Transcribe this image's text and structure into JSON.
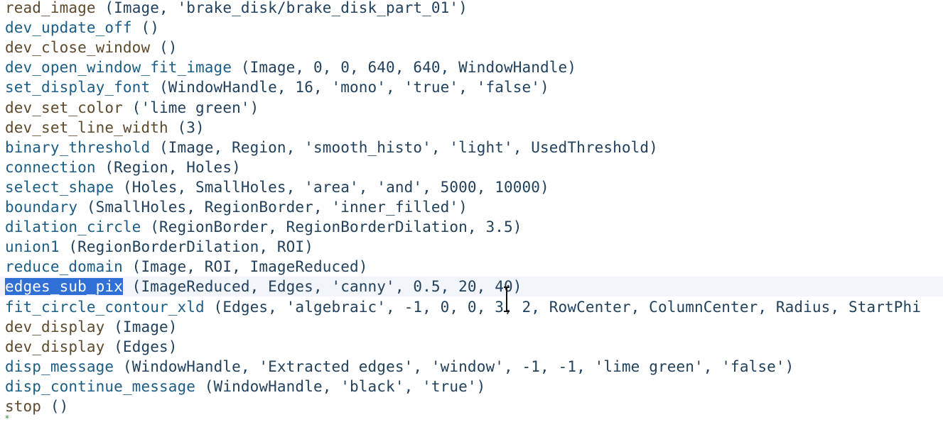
{
  "editor": {
    "lines": [
      {
        "op": "read_image",
        "args": " (Image, 'brake_disk/brake_disk_part_01')",
        "color": "#5e4a2c"
      },
      {
        "op": "dev_update_off",
        "args": " ()",
        "color": "#1a5d86"
      },
      {
        "op": "dev_close_window",
        "args": " ()",
        "color": "#5e4a2c"
      },
      {
        "op": "dev_open_window_fit_image",
        "args": " (Image, 0, 0, 640, 640, WindowHandle)",
        "color": "#1a5d86"
      },
      {
        "op": "set_display_font",
        "args": " (WindowHandle, 16, 'mono', 'true', 'false')",
        "color": "#1a5d86"
      },
      {
        "op": "dev_set_color",
        "args": " ('lime green')",
        "color": "#5e4a2c"
      },
      {
        "op": "dev_set_line_width",
        "args": " (3)",
        "color": "#5e4a2c"
      },
      {
        "op": "binary_threshold",
        "args": " (Image, Region, 'smooth_histo', 'light', UsedThreshold)",
        "color": "#1a5d86"
      },
      {
        "op": "connection",
        "args": " (Region, Holes)",
        "color": "#1a5d86"
      },
      {
        "op": "select_shape",
        "args": " (Holes, SmallHoles, 'area', 'and', 5000, 10000)",
        "color": "#1a5d86"
      },
      {
        "op": "boundary",
        "args": " (SmallHoles, RegionBorder, 'inner_filled')",
        "color": "#1a5d86"
      },
      {
        "op": "dilation_circle",
        "args": " (RegionBorder, RegionBorderDilation, 3.5)",
        "color": "#1a5d86"
      },
      {
        "op": "union1",
        "args": " (RegionBorderDilation, ROI)",
        "color": "#1a5d86"
      },
      {
        "op": "reduce_domain",
        "args": " (Image, ROI, ImageReduced)",
        "color": "#1a5d86"
      },
      {
        "op": "edges_sub_pix",
        "args": " (ImageReduced, Edges, 'canny', 0.5, 20, 40)",
        "color": "#1a5d86",
        "selected": true,
        "current": true
      },
      {
        "op": "fit_circle_contour_xld",
        "args": " (Edges, 'algebraic', -1, 0, 0, 3, 2, RowCenter, ColumnCenter, Radius, StartPhi",
        "color": "#1a5d86"
      },
      {
        "op": "dev_display",
        "args": " (Image)",
        "color": "#5e4a2c"
      },
      {
        "op": "dev_display",
        "args": " (Edges)",
        "color": "#5e4a2c"
      },
      {
        "op": "disp_message",
        "args": " (WindowHandle, 'Extracted edges', 'window', -1, -1, 'lime green', 'false')",
        "color": "#1a5d86"
      },
      {
        "op": "disp_continue_message",
        "args": " (WindowHandle, 'black', 'true')",
        "color": "#1a5d86"
      },
      {
        "op": "stop",
        "args": " ()",
        "color": "#5e4a2c"
      }
    ],
    "next_line_marker_icon": "pc-arrow-icon",
    "cursor_icon": "text-cursor-icon"
  }
}
